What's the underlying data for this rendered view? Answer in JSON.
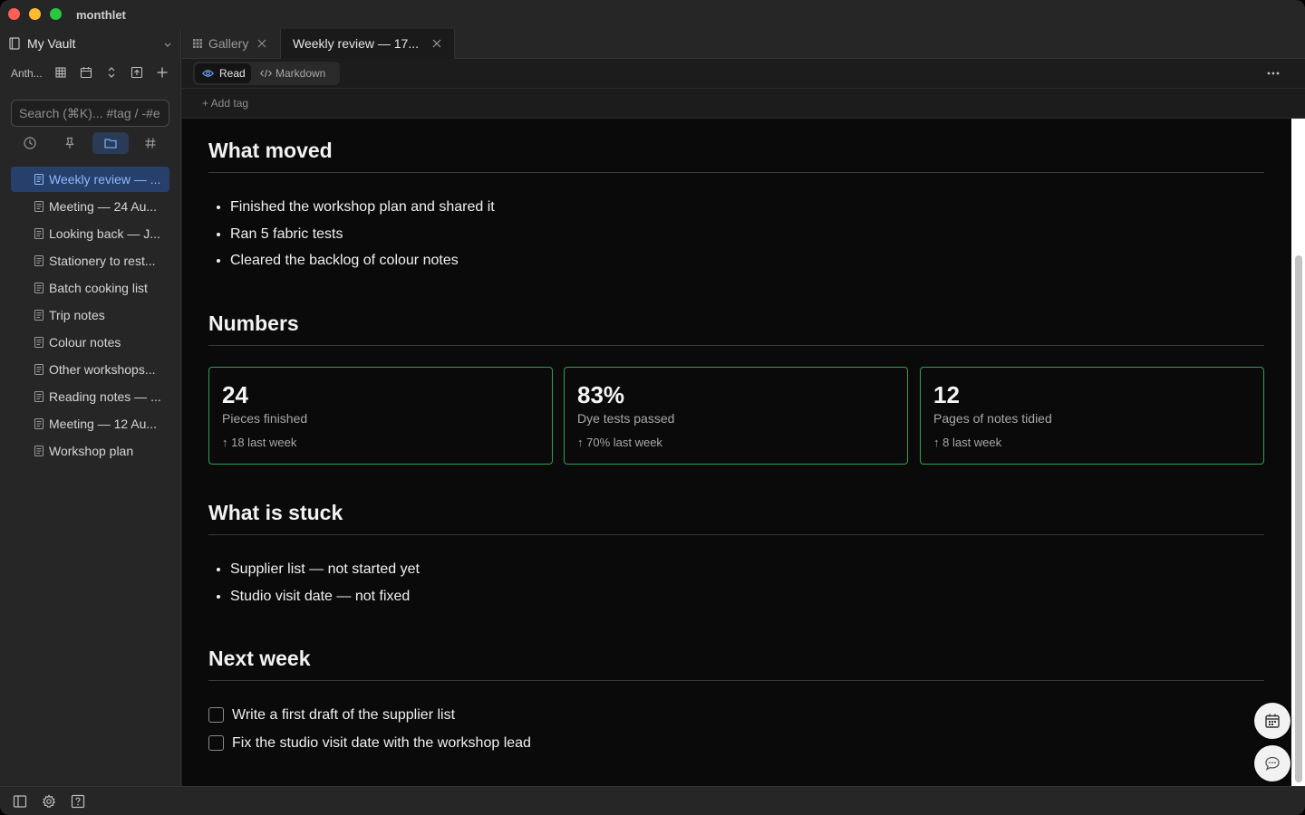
{
  "app": {
    "title": "monthlet"
  },
  "sidebar": {
    "vault_name": "My Vault",
    "toolbar_label": "Anth...",
    "search_placeholder": "Search (⌘K)... #tag / -#e",
    "files": [
      {
        "label": "Weekly review — ...",
        "active": true
      },
      {
        "label": "Meeting — 24 Au...",
        "active": false
      },
      {
        "label": "Looking back — J...",
        "active": false
      },
      {
        "label": "Stationery to rest...",
        "active": false
      },
      {
        "label": "Batch cooking list",
        "active": false
      },
      {
        "label": "Trip notes",
        "active": false
      },
      {
        "label": "Colour notes",
        "active": false
      },
      {
        "label": "Other workshops...",
        "active": false
      },
      {
        "label": "Reading notes — ...",
        "active": false
      },
      {
        "label": "Meeting — 12 Au...",
        "active": false
      },
      {
        "label": "Workshop plan",
        "active": false
      }
    ]
  },
  "tabs": [
    {
      "label": "Gallery",
      "active": false
    },
    {
      "label": "Weekly review — 17...",
      "active": true
    }
  ],
  "modes": {
    "read": "Read",
    "markdown": "Markdown"
  },
  "tagbar": {
    "add_tag": "+ Add tag"
  },
  "doc": {
    "moved_heading": "What moved",
    "moved_items": [
      "Finished the workshop plan and shared it",
      "Ran 5 fabric tests",
      "Cleared the backlog of colour notes"
    ],
    "numbers_heading": "Numbers",
    "stats": [
      {
        "value": "24",
        "label": "Pieces finished",
        "delta": "↑ 18 last week"
      },
      {
        "value": "83%",
        "label": "Dye tests passed",
        "delta": "↑ 70% last week"
      },
      {
        "value": "12",
        "label": "Pages of notes tidied",
        "delta": "↑ 8 last week"
      }
    ],
    "stuck_heading": "What is stuck",
    "stuck_items": [
      "Supplier list — not started yet",
      "Studio visit date — not fixed"
    ],
    "next_heading": "Next week",
    "tasks": [
      {
        "text": "Write a first draft of the supplier list",
        "checked": false
      },
      {
        "text": "Fix the studio visit date with the workshop lead",
        "checked": false
      }
    ]
  },
  "colors": {
    "accent": "#2f9e55",
    "active_file_bg": "#26406b",
    "link": "#8fb8ff"
  }
}
